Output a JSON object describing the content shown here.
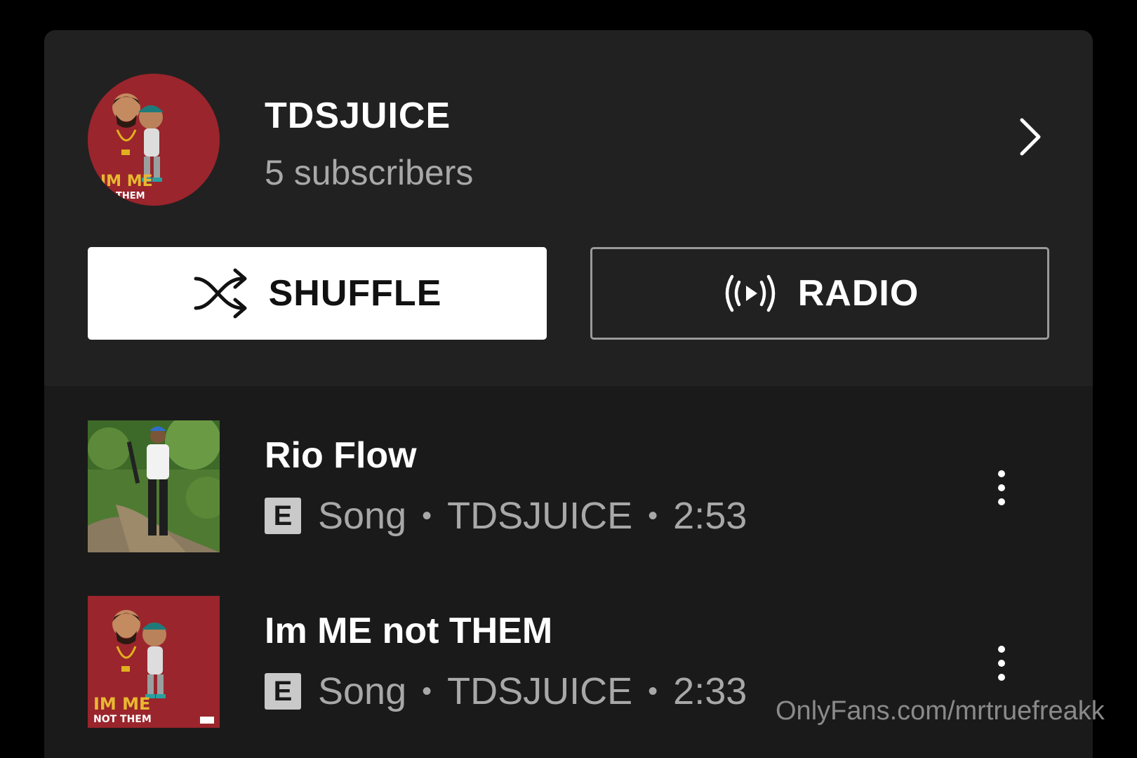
{
  "artist": {
    "name": "TDSJUICE",
    "subscribers": "5 subscribers",
    "avatar_text": [
      "IM ME",
      "THEM"
    ]
  },
  "actions": {
    "shuffle_label": "SHUFFLE",
    "radio_label": "RADIO"
  },
  "songs": [
    {
      "title": "Rio Flow",
      "explicit": "E",
      "type": "Song",
      "artist": "TDSJUICE",
      "duration": "2:53",
      "thumb_icon": "photo-thumbnail"
    },
    {
      "title": "Im ME not THEM",
      "explicit": "E",
      "type": "Song",
      "artist": "TDSJUICE",
      "duration": "2:33",
      "thumb_text": [
        "IM ME",
        "NOT THEM"
      ]
    }
  ],
  "separator": "•",
  "watermark": "OnlyFans.com/mrtruefreakk",
  "colors": {
    "background": "#000000",
    "card": "#212121",
    "list": "#1a1a1a",
    "secondary_text": "#a8a8a8",
    "accent_red": "#8c1f26"
  }
}
